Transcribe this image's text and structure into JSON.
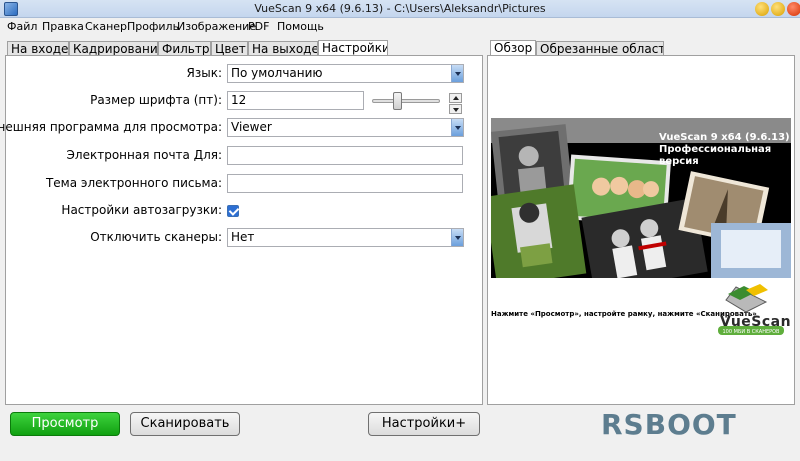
{
  "window": {
    "title": "VueScan 9 x64 (9.6.13) - C:\\Users\\Aleksandr\\Pictures"
  },
  "menu": [
    "Файл",
    "Правка",
    "Сканер",
    "Профиль",
    "Изображение",
    "PDF",
    "Помощь"
  ],
  "tabs_left": [
    {
      "label": "На входе"
    },
    {
      "label": "Кадрирование"
    },
    {
      "label": "Фильтр"
    },
    {
      "label": "Цвет"
    },
    {
      "label": "На выходе"
    },
    {
      "label": "Настройки"
    }
  ],
  "tabs_right": [
    {
      "label": "Обзор"
    },
    {
      "label": "Обрезанные область"
    }
  ],
  "settings": {
    "language_label": "Язык:",
    "language_value": "По умолчанию",
    "font_size_label": "Размер шрифта (пт):",
    "font_size_value": "12",
    "viewer_label": "Внешняя программа для просмотра:",
    "viewer_value": "Viewer",
    "email_label": "Электронная почта Для:",
    "email_value": "",
    "email_subject_label": "Тема электронного письма:",
    "email_subject_value": "",
    "autoload_label": "Настройки автозагрузки:",
    "autoload_checked": true,
    "disable_scanners_label": "Отключить сканеры:",
    "disable_scanners_value": "Нет"
  },
  "preview": {
    "splash_title_1": "VueScan 9 x64 (9.6.13)",
    "splash_title_2": "Профессиональная версия",
    "caption": "Нажмите «Просмотр», настройте рамку, нажмите «Сканировать»",
    "logo_text": "VueScan",
    "logo_tagline": "100 МБИ В СКАНЕРОВ"
  },
  "buttons": {
    "preview": "Просмотр",
    "scan": "Сканировать",
    "more_settings": "Настройки+"
  },
  "watermark": {
    "text": "RSBOOT"
  },
  "colors": {
    "preview_button": "#22b522",
    "checkbox": "#2d6fd3",
    "dropdown": "#6b9fdc"
  }
}
